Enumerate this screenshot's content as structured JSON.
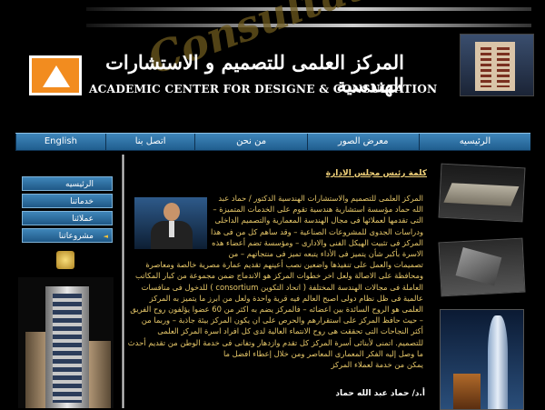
{
  "header": {
    "title_ar": "المركز العلمى للتصميم و الاستشارات الهندسية",
    "title_en": "ACADEMIC CENTER FOR DESIGNE & CONSULTATION",
    "watermark": "Consultation"
  },
  "nav": {
    "items": [
      {
        "label": "الرئيسيه"
      },
      {
        "label": "معرض الصور"
      },
      {
        "label": "من نحن"
      },
      {
        "label": "اتصل بنا"
      },
      {
        "label": "English"
      }
    ]
  },
  "sidebar": {
    "items": [
      {
        "label": "الرئيسيه"
      },
      {
        "label": "خدماتنا"
      },
      {
        "label": "عملائنا"
      },
      {
        "label": "مشروعاتنا"
      }
    ]
  },
  "main": {
    "section_title": "كلمة رئيس مجلس الادارة",
    "paragraph": "المركز العلمى للتصميم والاستشارات الهندسية الدكتور / حماد عبد الله حماد مؤسسة استشارية هندسية تقوم على الخدمات المتميزة – التى تقدمها لعملائها فى مجال الهندسة المعمارية والتصميم الداخلى ودراسات الجدوى للمشروعات الصناعية – وقد ساهم كل من فى هذا المركز فى تثبيت الهيكل الفنى والادارى – ومؤسسة تضم أعضاء هذه الاسرة بأكبر شأن يتميز فى الأداء يتبعه تميز فى منتجاتهم – من تصميمات والعمل على تنفيذها واضعين نصب أعينهم تقديم عمارة مصرية خالصة ومعاصرة ومحافظة على الاصالة ولعل اخر خطوات المركز هو الاندماج ضمن مجموعة من كبار المكاتب العاملة فى مجالات الهندسة المختلفة ( اتحاد التكوين consortium ) للدخول فى منافسات عالمية فى ظل نظام دولى اصبح العالم فيه قرية واحدة ولعل من ابرز ما يتميز به المركز العلمى هو الروح السائدة بين اعضائه – فالمركز يضم به اكثر من 60 عضوا يؤلفون روح الفريق – حيث حافظ المركز على استقرارهم والحرص على ان يكون المركز بيئة جاذبة – وربما من أكثر النجاحات التى تحققت هى روح الانتماء العالية لدى كل افراد اسرة المركز العلمى للتصميم. اتمنى لأبنائى أسرة المركز كل تقدم وازدهار وتفانى فى خدمة الوطن من تقديم أحدث ما وصل إليه الفكر المعمارى المعاصر ومن خلال إعطاء افضل ما",
    "closing": "يمكن من خدمة لعملاء المركز",
    "signature": "أ.د/ حماد عبد الله حماد"
  },
  "colors": {
    "nav_blue": "#2f74a8",
    "text_gold": "#e8c96a",
    "logo_orange": "#f28c1f"
  }
}
